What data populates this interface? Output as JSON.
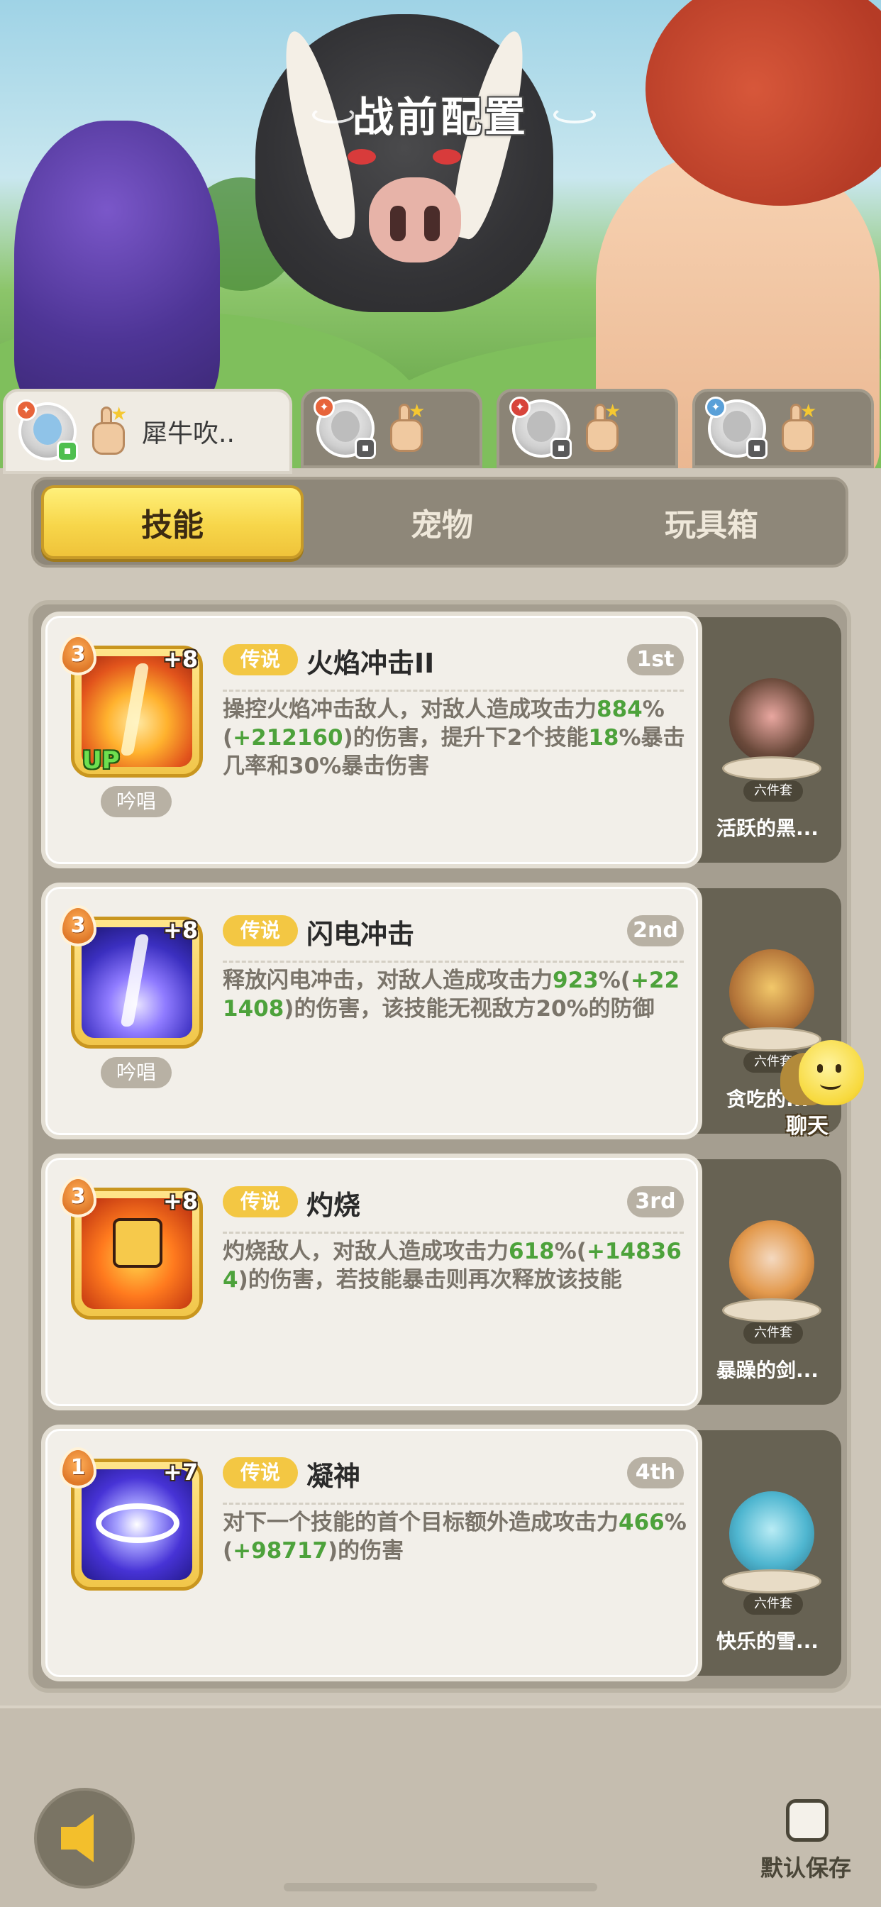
{
  "header": {
    "title": "战前配置"
  },
  "player_tabs": [
    {
      "name": "犀牛吹..",
      "active": true
    },
    {
      "name": "",
      "active": false
    },
    {
      "name": "",
      "active": false
    },
    {
      "name": "",
      "active": false
    }
  ],
  "category_tabs": [
    {
      "label": "技能",
      "active": true
    },
    {
      "label": "宠物",
      "active": false
    },
    {
      "label": "玩具箱",
      "active": false
    }
  ],
  "skills": [
    {
      "level": "3",
      "plus": "+8",
      "up": "UP",
      "chant": "吟唱",
      "rarity": "传说",
      "name": "火焰冲击II",
      "rank": "1st",
      "desc": [
        {
          "t": "操控火焰冲击敌人，对敌人造成攻击力"
        },
        {
          "t": "884",
          "g": true
        },
        {
          "t": "%("
        },
        {
          "t": "+212160",
          "g": true
        },
        {
          "t": ")的伤害，提升下2个技能"
        },
        {
          "t": "18",
          "g": true
        },
        {
          "t": "%暴击几率和30%暴击伤害"
        }
      ],
      "pet": {
        "set": "六件套",
        "name": "活跃的黑..."
      }
    },
    {
      "level": "3",
      "plus": "+8",
      "chant": "吟唱",
      "rarity": "传说",
      "name": "闪电冲击",
      "rank": "2nd",
      "desc": [
        {
          "t": "释放闪电冲击，对敌人造成攻击力"
        },
        {
          "t": "923",
          "g": true
        },
        {
          "t": "%("
        },
        {
          "t": "+221408",
          "g": true
        },
        {
          "t": ")的伤害，该技能无视敌方20%的防御"
        }
      ],
      "pet": {
        "set": "六件套",
        "name": "贪吃的..."
      }
    },
    {
      "level": "3",
      "plus": "+8",
      "rarity": "传说",
      "name": "灼烧",
      "rank": "3rd",
      "desc": [
        {
          "t": "灼烧敌人，对敌人造成攻击力"
        },
        {
          "t": "618",
          "g": true
        },
        {
          "t": "%("
        },
        {
          "t": "+148364",
          "g": true
        },
        {
          "t": ")的伤害，若技能暴击则再次释放该技能"
        }
      ],
      "pet": {
        "set": "六件套",
        "name": "暴躁的剑..."
      }
    },
    {
      "level": "1",
      "plus": "+7",
      "rarity": "传说",
      "name": "凝神",
      "rank": "4th",
      "desc": [
        {
          "t": "对下一个技能的首个目标额外造成攻击力"
        },
        {
          "t": "466",
          "g": true
        },
        {
          "t": "%("
        },
        {
          "t": "+98717",
          "g": true
        },
        {
          "t": ")的伤害"
        }
      ],
      "pet": {
        "set": "六件套",
        "name": "快乐的雪..."
      }
    }
  ],
  "chat": {
    "label": "聊天"
  },
  "footer": {
    "save_label": "默认保存",
    "save_checked": false
  },
  "colors": {
    "accent_yellow": "#f3c743",
    "highlight_green": "#4da23b",
    "panel_dark": "#676253"
  }
}
